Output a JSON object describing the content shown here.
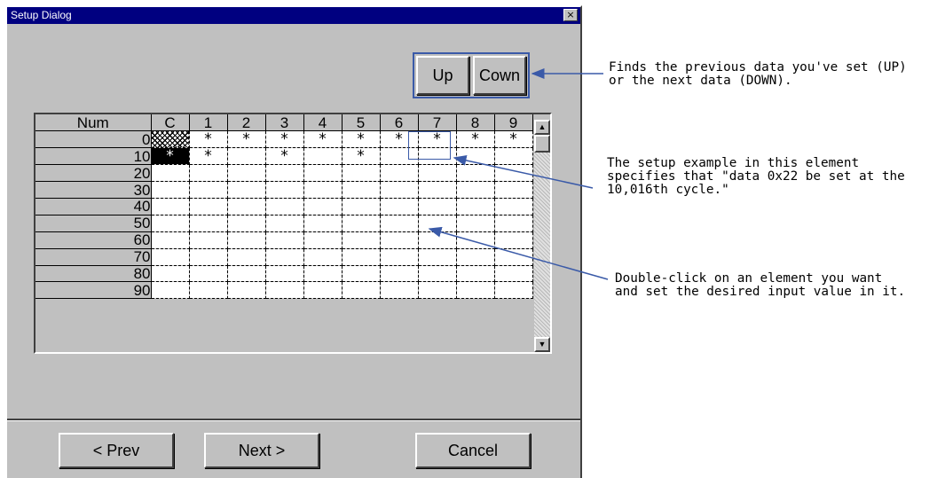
{
  "dialog": {
    "title": "Setup Dialog",
    "close_label": "×"
  },
  "nav_buttons": {
    "up_label": "Up",
    "down_label": "Cown"
  },
  "grid": {
    "corner_label": "Num",
    "columns": [
      "C",
      "1",
      "2",
      "3",
      "4",
      "5",
      "6",
      "7",
      "8",
      "9"
    ],
    "rows": [
      {
        "label": "0",
        "cells": [
          "",
          "*",
          "*",
          "*",
          "*",
          "*",
          "*",
          "*",
          "*",
          "*"
        ]
      },
      {
        "label": "10",
        "cells": [
          "*",
          "*",
          "",
          "*",
          "",
          "*",
          "",
          "",
          "",
          ""
        ]
      },
      {
        "label": "20",
        "cells": [
          "",
          "",
          "",
          "",
          "",
          "",
          "",
          "",
          "",
          ""
        ]
      },
      {
        "label": "30",
        "cells": [
          "",
          "",
          "",
          "",
          "",
          "",
          "",
          "",
          "",
          ""
        ]
      },
      {
        "label": "40",
        "cells": [
          "",
          "",
          "",
          "",
          "",
          "",
          "",
          "",
          "",
          ""
        ]
      },
      {
        "label": "50",
        "cells": [
          "",
          "",
          "",
          "",
          "",
          "",
          "",
          "",
          "",
          ""
        ]
      },
      {
        "label": "60",
        "cells": [
          "",
          "",
          "",
          "",
          "",
          "",
          "",
          "",
          "",
          ""
        ]
      },
      {
        "label": "70",
        "cells": [
          "",
          "",
          "",
          "",
          "",
          "",
          "",
          "",
          "",
          ""
        ]
      },
      {
        "label": "80",
        "cells": [
          "",
          "",
          "",
          "",
          "",
          "",
          "",
          "",
          "",
          ""
        ]
      },
      {
        "label": "90",
        "cells": [
          "",
          "",
          "",
          "",
          "",
          "",
          "",
          "",
          "",
          ""
        ]
      }
    ]
  },
  "scrollbar": {
    "up_arrow": "▲",
    "down_arrow": "▼"
  },
  "footer": {
    "prev_label": "< Prev",
    "next_label": "Next >",
    "cancel_label": "Cancel"
  },
  "annotations": {
    "updown_note": "Finds the previous data you've set (UP)\nor the next data (DOWN).",
    "element_note": "The setup example in this element\nspecifies that \"data 0x22 be set at the\n10,016th cycle.\"",
    "dblclick_note": "Double-click on an element you want\nand set the desired input value in it."
  },
  "colors": {
    "title_bar": "#000080",
    "dialog_face": "#c0c0c0",
    "annotation_line": "#3a5aa8"
  }
}
